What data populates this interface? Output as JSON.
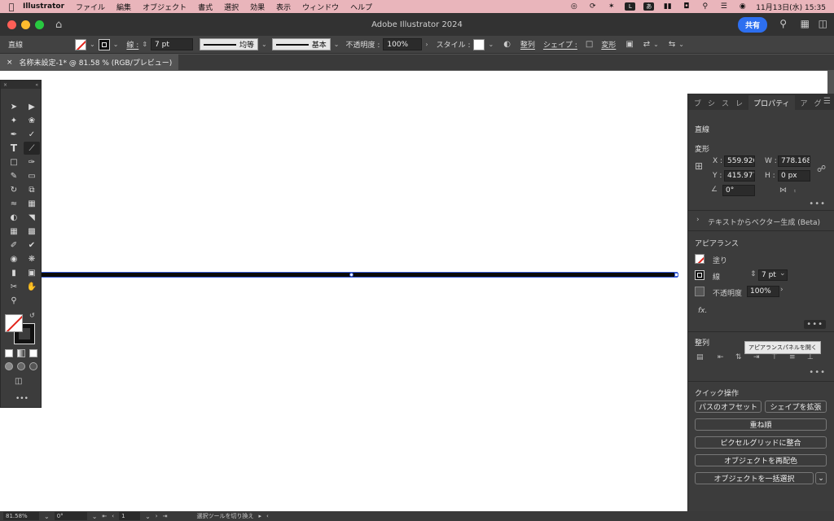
{
  "menubar": {
    "app": "Illustrator",
    "items": [
      "ファイル",
      "編集",
      "オブジェクト",
      "書式",
      "選択",
      "効果",
      "表示",
      "ウィンドウ",
      "ヘルプ"
    ],
    "ime": "あ",
    "datetime": "11月13日(水) 15:35"
  },
  "titlebar": {
    "title": "Adobe Illustrator 2024",
    "share": "共有"
  },
  "control": {
    "object_type": "直線",
    "stroke_label": "線 :",
    "stroke_weight": "7 pt",
    "profile_label": "均等",
    "brush_label": "基本",
    "opacity_label": "不透明度 :",
    "opacity_value": "100%",
    "style_label": "スタイル :",
    "align_link": "整列",
    "shape_link": "シェイプ :",
    "transform_link": "変形"
  },
  "document": {
    "tab_title": "名称未設定-1* @ 81.58 % (RGB/プレビュー)"
  },
  "panel": {
    "tabs": [
      "ブ",
      "シ",
      "ス",
      "レ",
      "プロパティ",
      "ア",
      "グ"
    ],
    "object_type": "直線",
    "transform": {
      "title": "変形",
      "x_label": "X :",
      "x_value": "559.926",
      "y_label": "Y :",
      "y_value": "415.977",
      "w_label": "W :",
      "w_value": "778.168",
      "h_label": "H :",
      "h_value": "0 px",
      "angle_value": "0°"
    },
    "text_to_vector": "テキストからベクター生成 (Beta)",
    "appearance": {
      "title": "アピアランス",
      "fill_label": "塗り",
      "stroke_label": "線",
      "stroke_value": "7 pt",
      "opacity_label": "不透明度",
      "opacity_value": "100%",
      "fx": "fx."
    },
    "tooltip": "アピアランスパネルを開く",
    "align_title": "整列",
    "quick_actions": {
      "title": "クイック操作",
      "offset_path": "パスのオフセット",
      "expand_shape": "シェイプを拡張",
      "arrange": "重ね順",
      "pixel_grid": "ピクセルグリッドに整合",
      "recolor": "オブジェクトを再配色",
      "select_same": "オブジェクトを一括選択"
    }
  },
  "statusbar": {
    "zoom": "81.58%",
    "rotation": "0°",
    "artboard": "1",
    "tool_hint": "選択ツールを切り換え"
  },
  "colors": {
    "menubar_bg": "#e9b5bb",
    "accent": "#2d6ff0",
    "panel_bg": "#3c3c3c",
    "canvas_bg": "#ffffff",
    "selection": "#3a5ed8"
  }
}
